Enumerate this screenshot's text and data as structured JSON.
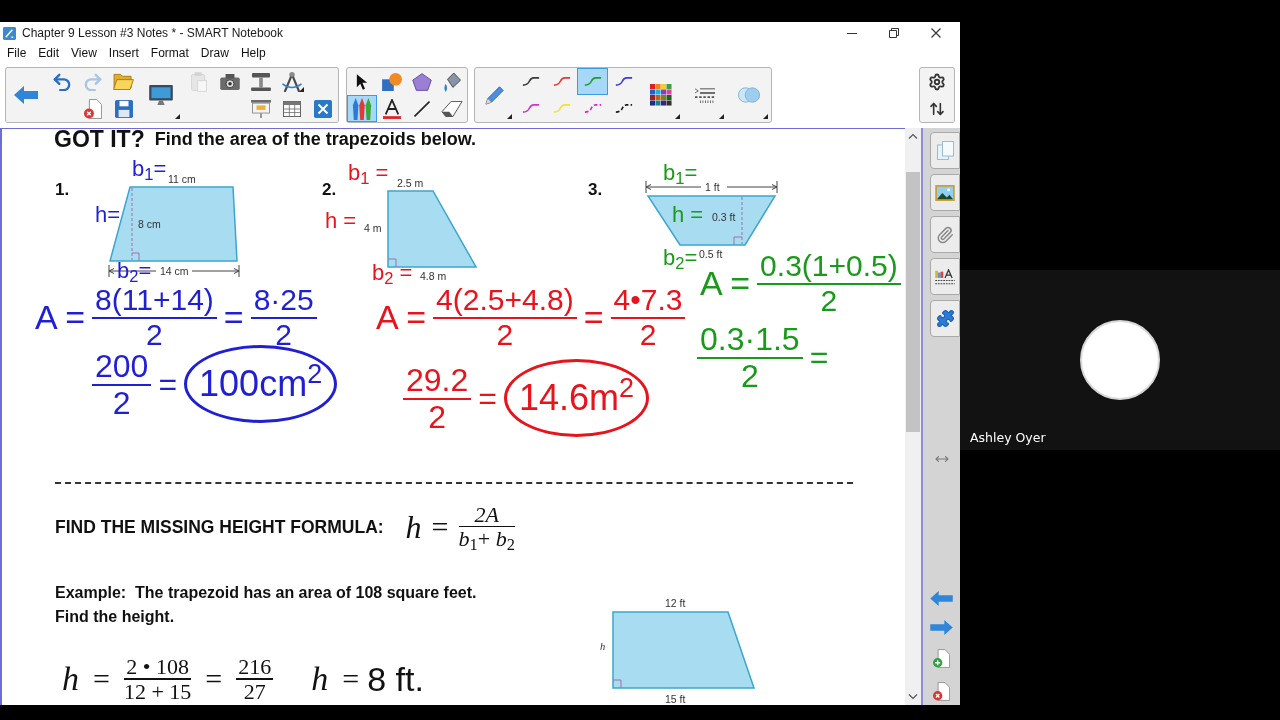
{
  "window": {
    "title": "Chapter 9 Lesson #3 Notes * - SMART Notebook"
  },
  "menu": [
    "File",
    "Edit",
    "View",
    "Insert",
    "Format",
    "Draw",
    "Help"
  ],
  "toolbar": {
    "actions": [
      {
        "kind": "back",
        "disabled": false
      },
      {
        "kind": "undo",
        "disabled": false
      },
      {
        "kind": "redo",
        "disabled": true
      },
      {
        "kind": "open",
        "disabled": false
      },
      {
        "kind": "delete-page",
        "disabled": false
      },
      {
        "kind": "save",
        "disabled": false
      },
      {
        "kind": "screen-capture",
        "disabled": false
      },
      {
        "kind": "paste",
        "disabled": true
      },
      {
        "kind": "camera",
        "disabled": false
      },
      {
        "kind": "document-camera",
        "disabled": false
      },
      {
        "kind": "measure",
        "disabled": false
      },
      {
        "kind": "screen-shade",
        "disabled": false
      },
      {
        "kind": "table",
        "disabled": false
      },
      {
        "kind": "delete",
        "disabled": false
      }
    ],
    "tools": [
      {
        "kind": "select",
        "selected": false
      },
      {
        "kind": "shapes",
        "selected": false
      },
      {
        "kind": "polygons",
        "selected": false
      },
      {
        "kind": "fill",
        "selected": false
      },
      {
        "kind": "pens",
        "selected": true
      },
      {
        "kind": "text",
        "selected": false
      },
      {
        "kind": "line",
        "selected": false
      },
      {
        "kind": "eraser",
        "selected": false
      }
    ],
    "pen_styles": [
      {
        "kind": "solid",
        "color": "#3a3a3a",
        "selected": false
      },
      {
        "kind": "solid",
        "color": "#e53935",
        "selected": false
      },
      {
        "kind": "solid",
        "color": "#1e9e2a",
        "selected": true
      },
      {
        "kind": "solid",
        "color": "#3d3dd8",
        "selected": false
      },
      {
        "kind": "solid",
        "color": "#c43cc4",
        "selected": false
      },
      {
        "kind": "solid",
        "color": "#f0e040",
        "selected": false
      },
      {
        "kind": "dashed",
        "color": "#e81cc0",
        "selected": false
      },
      {
        "kind": "dashed",
        "color": "#1a1a1a",
        "selected": false
      }
    ]
  },
  "page": {
    "heading": {
      "lead": "GOT IT?",
      "text": "Find the area of the trapezoids below."
    },
    "problems": [
      {
        "number": "1.",
        "color": "#1f1fd4",
        "figure": {
          "kind": "left-leg",
          "top": "11 cm",
          "height": "8 cm",
          "bottom": "14 cm"
        },
        "ink_labels": [
          "b$_{1}$=",
          "h=",
          "b$_{2}$="
        ],
        "work": [
          [
            {
              "kind": "text",
              "text": "A ="
            },
            {
              "kind": "fraction",
              "numerator": "8(11+14)",
              "denominator": "2"
            },
            {
              "kind": "text",
              "text": "="
            },
            {
              "kind": "fraction",
              "numerator": "8·25",
              "denominator": "2"
            }
          ],
          [
            {
              "kind": "fraction",
              "numerator": "200",
              "denominator": "2"
            },
            {
              "kind": "text",
              "text": "="
            },
            {
              "kind": "circled",
              "text": "100cm$^{2}$"
            }
          ]
        ]
      },
      {
        "number": "2.",
        "color": "#e8141c",
        "figure": {
          "kind": "right-leg",
          "top": "2.5 m",
          "height": "4 m",
          "bottom": "4.8 m"
        },
        "ink_labels": [
          "b$_{1}$ =",
          "h =",
          "b$_{2}$ ="
        ],
        "work": [
          [
            {
              "kind": "text",
              "text": "A ="
            },
            {
              "kind": "fraction",
              "numerator": "4(2.5+4.8)",
              "denominator": "2"
            },
            {
              "kind": "text",
              "text": "="
            },
            {
              "kind": "fraction",
              "numerator": "4•7.3",
              "denominator": "2"
            }
          ],
          [
            {
              "kind": "fraction",
              "numerator": "29.2",
              "denominator": "2"
            },
            {
              "kind": "text",
              "text": "="
            },
            {
              "kind": "circled",
              "text": "14.6m$^{2}$"
            }
          ]
        ]
      },
      {
        "number": "3.",
        "color": "#1a9a1a",
        "figure": {
          "kind": "inverted",
          "top": "1 ft",
          "height": "0.3 ft",
          "bottom": "0.5 ft"
        },
        "ink_labels": [
          "b$_{1}$=",
          "h =",
          "b$_{2}$="
        ],
        "work": [
          [
            {
              "kind": "text",
              "text": "A ="
            },
            {
              "kind": "fraction",
              "numerator": "0.3(1+0.5)",
              "denominator": "2"
            }
          ],
          [
            {
              "kind": "fraction",
              "numerator": "0.3·1.5",
              "denominator": "2"
            },
            {
              "kind": "text",
              "text": "="
            }
          ]
        ]
      }
    ],
    "height_formula": {
      "label": "FIND THE MISSING HEIGHT FORMULA:",
      "terms": [
        {
          "kind": "variable",
          "text": "h"
        },
        {
          "kind": "text",
          "text": "="
        },
        {
          "kind": "variable-fraction",
          "numerator": "2A",
          "denominator": "*b*$_{1}$+ *b*$_{2}$"
        }
      ]
    },
    "example": {
      "lines": [
        "Example:  The trapezoid has an area of 108 square feet.",
        "Find the height."
      ],
      "figure": {
        "top": "12 ft",
        "height": "h",
        "bottom": "15 ft"
      },
      "solution": [
        {
          "kind": "variable",
          "text": "h"
        },
        {
          "kind": "text",
          "text": "="
        },
        {
          "kind": "fraction",
          "numerator": "2 • 108",
          "denominator": "12 + 15"
        },
        {
          "kind": "text",
          "text": "="
        },
        {
          "kind": "fraction",
          "numerator": "216",
          "denominator": "27"
        },
        {
          "kind": "variable",
          "text": "h"
        },
        {
          "kind": "text",
          "text": "="
        },
        {
          "kind": "answer",
          "text": "8 ft."
        }
      ]
    }
  },
  "participant": {
    "name": "Ashley Oyer"
  }
}
